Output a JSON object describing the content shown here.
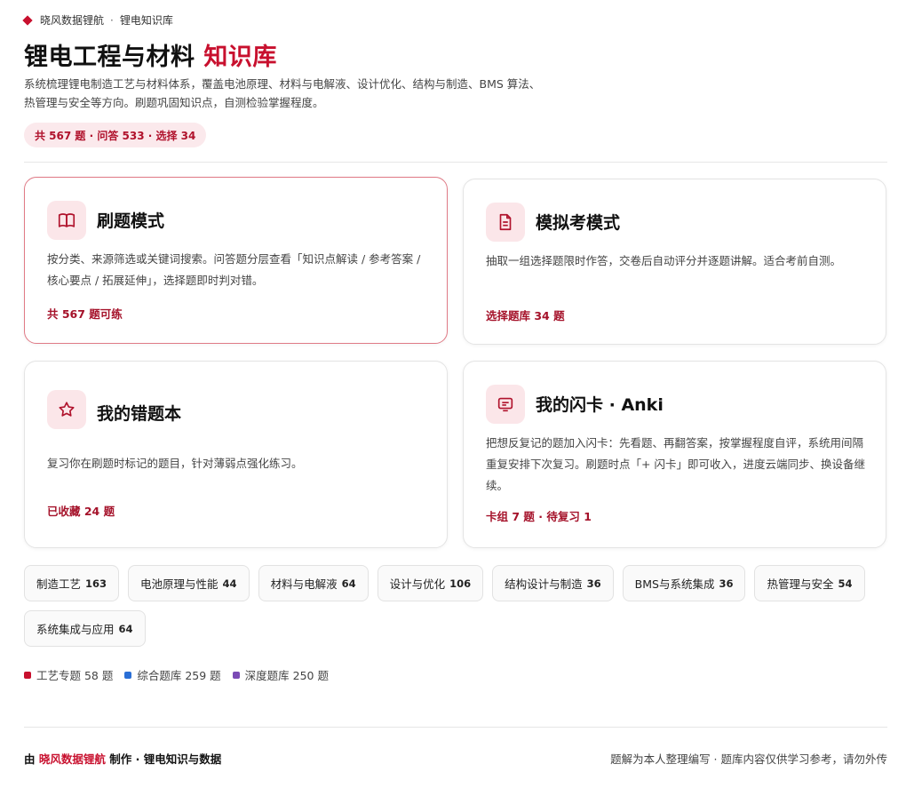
{
  "topbar": {
    "brand": "晓风数据锂航",
    "sep": "·",
    "section": "锂电知识库"
  },
  "header": {
    "title_main": "锂电工程与材料",
    "title_accent": "知识库",
    "description": "系统梳理锂电制造工艺与材料体系，覆盖电池原理、材料与电解液、设计优化、结构与制造、BMS 算法、热管理与安全等方向。刷题巩固知识点，自测检验掌握程度。",
    "stats": "共 567 题 · 问答 533 · 选择 34"
  },
  "cards": [
    {
      "icon": "book-icon",
      "title": "刷题模式",
      "description": "按分类、来源筛选或关键词搜索。问答题分层查看「知识点解读 / 参考答案 / 核心要点 / 拓展延伸」，选择题即时判对错。",
      "meta": "共 567 题可练"
    },
    {
      "icon": "document-icon",
      "title": "模拟考模式",
      "description": "抽取一组选择题限时作答，交卷后自动评分并逐题讲解。适合考前自测。",
      "meta": "选择题库 34 题"
    },
    {
      "icon": "star-icon",
      "title": "我的错题本",
      "description": "复习你在刷题时标记的题目，针对薄弱点强化练习。",
      "meta": "已收藏 24 题"
    },
    {
      "icon": "flashcard-icon",
      "title": "我的闪卡 · Anki",
      "description": "把想反复记的题加入闪卡：先看题、再翻答案，按掌握程度自评，系统用间隔重复安排下次复习。刷题时点「+ 闪卡」即可收入，进度云端同步、换设备继续。",
      "meta": "卡组 7 题 · 待复习 1"
    }
  ],
  "categories": [
    {
      "label": "制造工艺",
      "count": "163"
    },
    {
      "label": "电池原理与性能",
      "count": "44"
    },
    {
      "label": "材料与电解液",
      "count": "64"
    },
    {
      "label": "设计与优化",
      "count": "106"
    },
    {
      "label": "结构设计与制造",
      "count": "36"
    },
    {
      "label": "BMS与系统集成",
      "count": "36"
    },
    {
      "label": "热管理与安全",
      "count": "54"
    },
    {
      "label": "系统集成与应用",
      "count": "64"
    }
  ],
  "legend": [
    {
      "label": "工艺专题 58 题",
      "color": "#c8102e"
    },
    {
      "label": "综合题库 259 题",
      "color": "#2a6fd6"
    },
    {
      "label": "深度题库 250 题",
      "color": "#7b4bb5"
    }
  ],
  "footer": {
    "prefix": "由",
    "brand": "晓风数据锂航",
    "suffix": "制作 · 锂电知识与数据",
    "right": "题解为本人整理编写 · 题库内容仅供学习参考，请勿外传"
  }
}
